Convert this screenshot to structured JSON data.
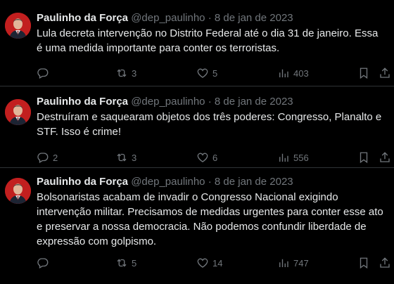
{
  "tweets": [
    {
      "author": {
        "name": "Paulinho da Força",
        "handle": "@dep_paulinho",
        "separator": "·",
        "date": "8 de jan de 2023"
      },
      "text": "Lula decreta intervenção no Distrito Federal até o dia 31 de janeiro. Essa é uma medida importante para conter os terroristas.",
      "stats": {
        "replies": "",
        "retweets": "3",
        "likes": "5",
        "views": "403"
      }
    },
    {
      "author": {
        "name": "Paulinho da Força",
        "handle": "@dep_paulinho",
        "separator": "·",
        "date": "8 de jan de 2023"
      },
      "text": "Destruíram e saquearam objetos dos três poderes: Congresso, Planalto e STF. Isso é crime!",
      "stats": {
        "replies": "2",
        "retweets": "3",
        "likes": "6",
        "views": "556"
      }
    },
    {
      "author": {
        "name": "Paulinho da Força",
        "handle": "@dep_paulinho",
        "separator": "·",
        "date": "8 de jan de 2023"
      },
      "text": "Bolsonaristas acabam de invadir o Congresso Nacional exigindo intervenção militar. Precisamos de medidas urgentes para conter esse ato e preservar a nossa democracia. Não podemos confundir liberdade de expressão com golpismo.",
      "stats": {
        "replies": "",
        "retweets": "5",
        "likes": "14",
        "views": "747"
      }
    }
  ],
  "icons": {
    "reply": "reply-icon",
    "retweet": "retweet-icon",
    "like": "heart-icon",
    "views": "views-icon",
    "bookmark": "bookmark-icon",
    "share": "share-icon"
  },
  "colors": {
    "background": "#000000",
    "text": "#e7e9ea",
    "muted": "#71767b",
    "divider": "#2f3336",
    "avatar": "#c21f1f"
  }
}
